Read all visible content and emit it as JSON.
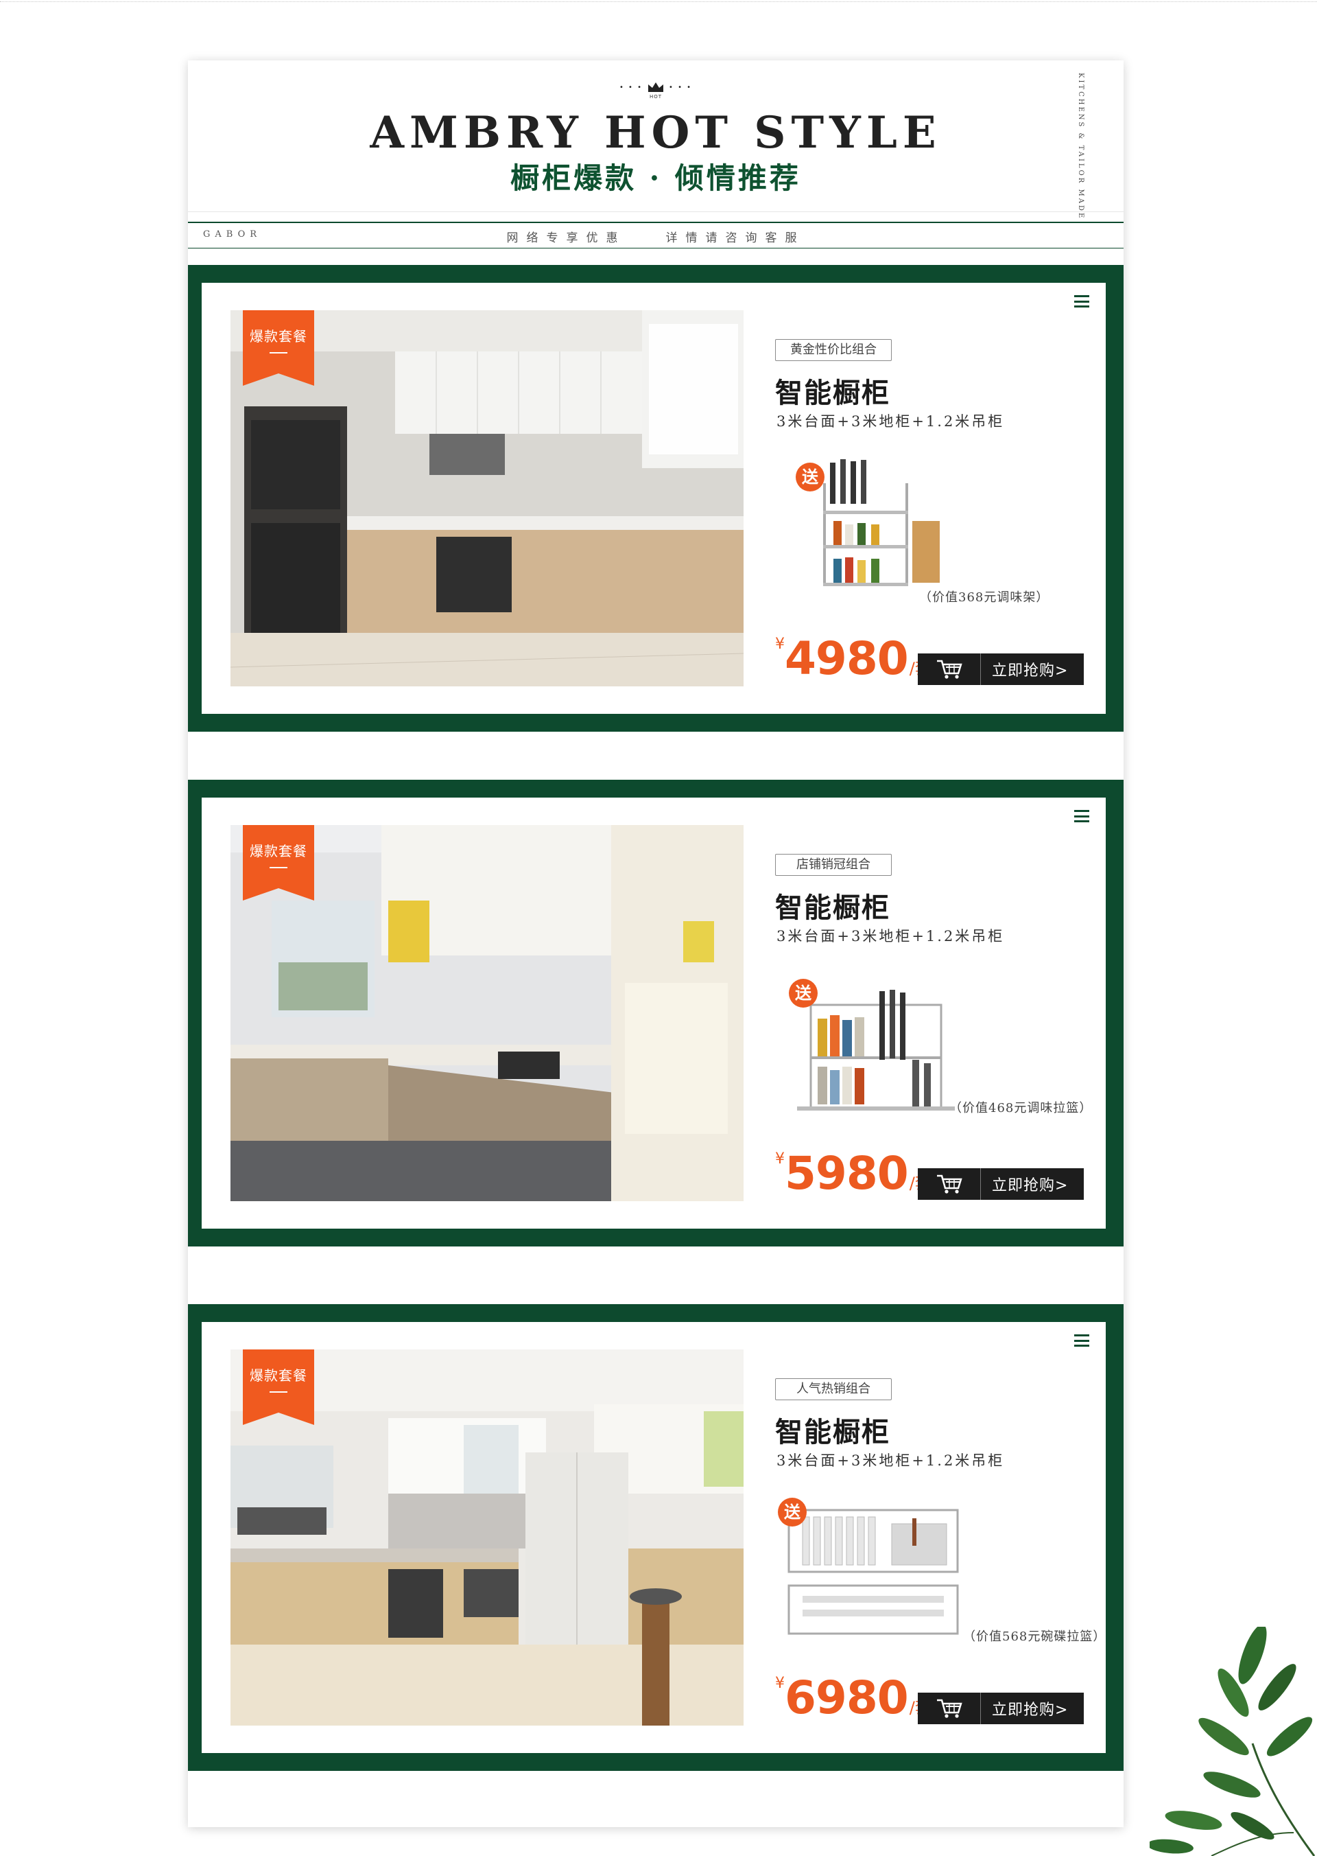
{
  "header": {
    "crown_label": "HOT",
    "title_en": "AMBRY HOT STYLE",
    "title_cn": "橱柜爆款 · 倾情推荐",
    "vertical_text": "KITCHENS & TAILOR MADE",
    "brand": "GABOR",
    "promo": "网络专享优惠　　详情请咨询客服"
  },
  "colors": {
    "frame_green": "#0d4a2e",
    "title_green": "#0e5230",
    "price_orange": "#ec5a20",
    "button_dark": "#1d1d1d"
  },
  "products": [
    {
      "ribbon": "爆款套餐",
      "tag": "黄金性价比组合",
      "name": "智能橱柜",
      "spec": "3米台面+3米地柜+1.2米吊柜",
      "gift_badge": "送",
      "gift_note": "（价值368元调味架）",
      "gift_icon": "spice-rack-icon",
      "price_currency": "¥",
      "price": "4980",
      "price_unit": "/套",
      "buy_label": "立即抢购>"
    },
    {
      "ribbon": "爆款套餐",
      "tag": "店铺销冠组合",
      "name": "智能橱柜",
      "spec": "3米台面+3米地柜+1.2米吊柜",
      "gift_badge": "送",
      "gift_note": "（价值468元调味拉篮）",
      "gift_icon": "seasoning-pull-basket-icon",
      "price_currency": "¥",
      "price": "5980",
      "price_unit": "/套",
      "buy_label": "立即抢购>"
    },
    {
      "ribbon": "爆款套餐",
      "tag": "人气热销组合",
      "name": "智能橱柜",
      "spec": "3米台面+3米地柜+1.2米吊柜",
      "gift_badge": "送",
      "gift_note": "（价值568元碗碟拉篮）",
      "gift_icon": "dish-pull-basket-icon",
      "price_currency": "¥",
      "price": "6980",
      "price_unit": "/套",
      "buy_label": "立即抢购>"
    }
  ]
}
